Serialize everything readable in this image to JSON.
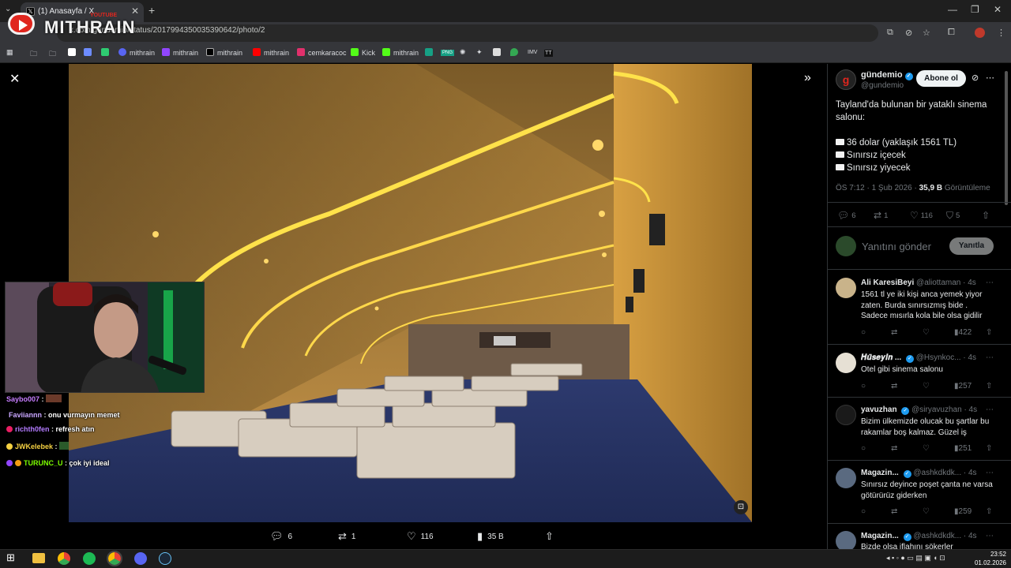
{
  "browser": {
    "tab_title": "(1) Anasayfa / X",
    "url": "x.com/gundemio/status/2017994350035390642/photo/2",
    "bookmarks": [
      "mithrain",
      "mithrain",
      "mithrain",
      "mithrain",
      "cemkaracoc",
      "Kick",
      "mithrain"
    ],
    "bookmark_icons": [
      "PNG",
      "IMV",
      "TT"
    ]
  },
  "overlay": {
    "logo_text": "MITHRAIN",
    "logo_sub": "YOUTUBE"
  },
  "photo_actions": {
    "replies": "6",
    "reposts": "1",
    "likes": "116",
    "views": "35 B"
  },
  "tweet": {
    "name": "gündemio",
    "handle": "@gundemio",
    "follow_label": "Abone ol",
    "text_line1": "Tayland'da bulunan bir yataklı sinema salonu:",
    "bullet1": "36 dolar (yaklaşık 1561 TL)",
    "bullet2": "Sınırsız içecek",
    "bullet3": "Sınırsız yiyecek",
    "meta_time": "ÖS 7:12 · 1 Şub 2026 · ",
    "meta_views": "35,9 B",
    "meta_views_label": " Görüntüleme",
    "stats": {
      "replies": "6",
      "reposts": "1",
      "likes": "116",
      "bookmarks": "5"
    },
    "reply_placeholder": "Yanıtını gönder",
    "reply_button": "Yanıtla"
  },
  "comments": [
    {
      "name": "Ali KaresiBeyi",
      "handle": "@aliottaman",
      "time": "· 4s",
      "text": "1561 tl ye iki kişi anca yemek yiyor zaten. Burda sınırsızmış bide . Sadece mısırla kola bile olsa gidilir",
      "views": "422"
    },
    {
      "name": "𝑯𝒖̈𝒔𝒆𝒚𝒊𝒏 ...",
      "handle": "@Hsynkoc...",
      "time": "· 4s",
      "text": "Otel gibi sinema salonu",
      "views": "257"
    },
    {
      "name": "yavuzhan",
      "handle": "@siryavuzhan",
      "time": "· 4s",
      "text": "Bizim ülkemizde olucak bu şartlar bu rakamlar boş kalmaz. Güzel iş",
      "views": "251"
    },
    {
      "name": "Magazin...",
      "handle": "@ashkdkdk...",
      "time": "· 4s",
      "text": "Sınırsız deyince poşet çanta ne varsa götürürüz giderken",
      "views": "259"
    },
    {
      "name": "Magazin...",
      "handle": "@ashkdkdk...",
      "time": "· 4s",
      "text": "Bizde olsa iflahını sökerler",
      "views": ""
    }
  ],
  "chat": [
    {
      "user": "Saybo007",
      "message": "",
      "color": "#c77dff"
    },
    {
      "user": "Faviiannn",
      "message": "onu vurmayın memet",
      "color": "#c9a7ff"
    },
    {
      "user": "richth0fen",
      "message": "refresh atın",
      "color": "#b37bff"
    },
    {
      "user": "JWKelebek",
      "message": "",
      "color": "#f5d142"
    },
    {
      "user": "TURUNC_U",
      "message": "çok iyi ideal",
      "color": "#7cfc00"
    }
  ],
  "taskbar": {
    "time": "23:52",
    "date": "01.02.2026"
  },
  "colors": {
    "x_blue": "#1d9bf0",
    "background": "#000000",
    "muted": "#71767b",
    "youtube_red": "#e0261e"
  }
}
